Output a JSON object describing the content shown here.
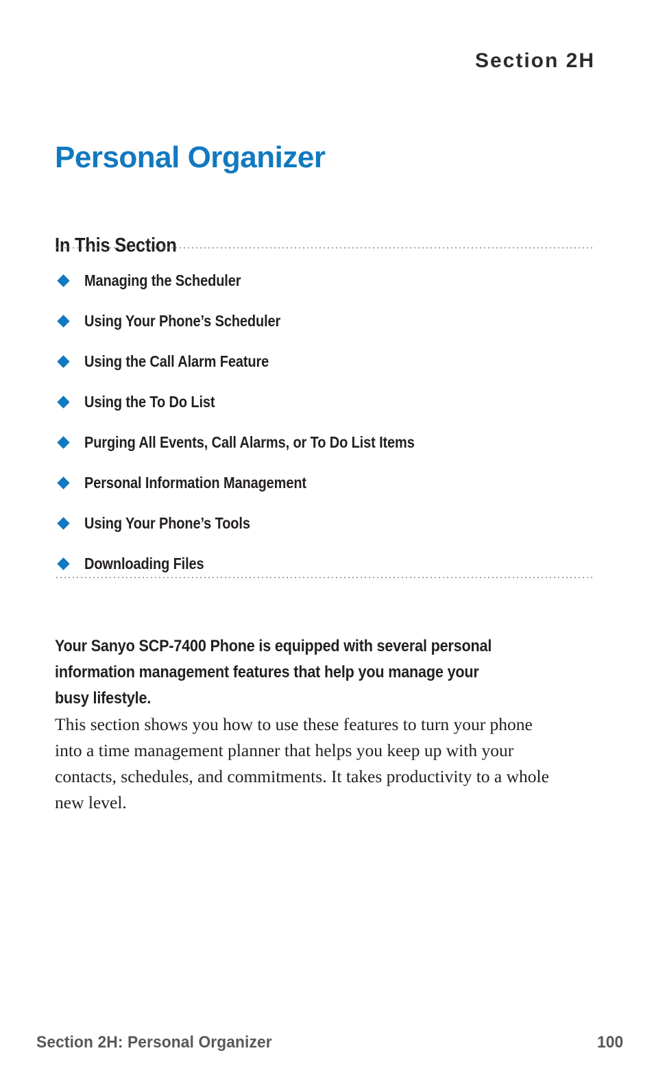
{
  "page": {
    "running_head": "Section 2H",
    "section_title": "Personal Organizer",
    "in_this_section_heading": "In This Section"
  },
  "toc": {
    "items": [
      {
        "label": "Managing the Scheduler"
      },
      {
        "label": "Using Your Phone’s Scheduler"
      },
      {
        "label": "Using the Call Alarm Feature"
      },
      {
        "label": "Using the To Do List"
      },
      {
        "label": "Purging All Events, Call Alarms, or To Do List Items"
      },
      {
        "label": "Personal Information Management"
      },
      {
        "label": "Using Your Phone’s Tools"
      },
      {
        "label": "Downloading Files"
      }
    ]
  },
  "intro": {
    "lead_in": "Your Sanyo SCP-7400 Phone is equipped with several personal information management features that help you manage your busy lifestyle.",
    "rest": " This section shows you how to use these features to turn your phone into a time management planner that helps you keep up with your contacts, schedules, and commitments. It takes productivity to a whole new level."
  },
  "footer": {
    "left": "Section 2H: Personal Organizer",
    "page_number": "100"
  },
  "colors": {
    "accent_blue": "#1179bf",
    "text_black": "#231f20",
    "footer_gray": "#58585b",
    "rule_gray": "#8d8d8d"
  }
}
